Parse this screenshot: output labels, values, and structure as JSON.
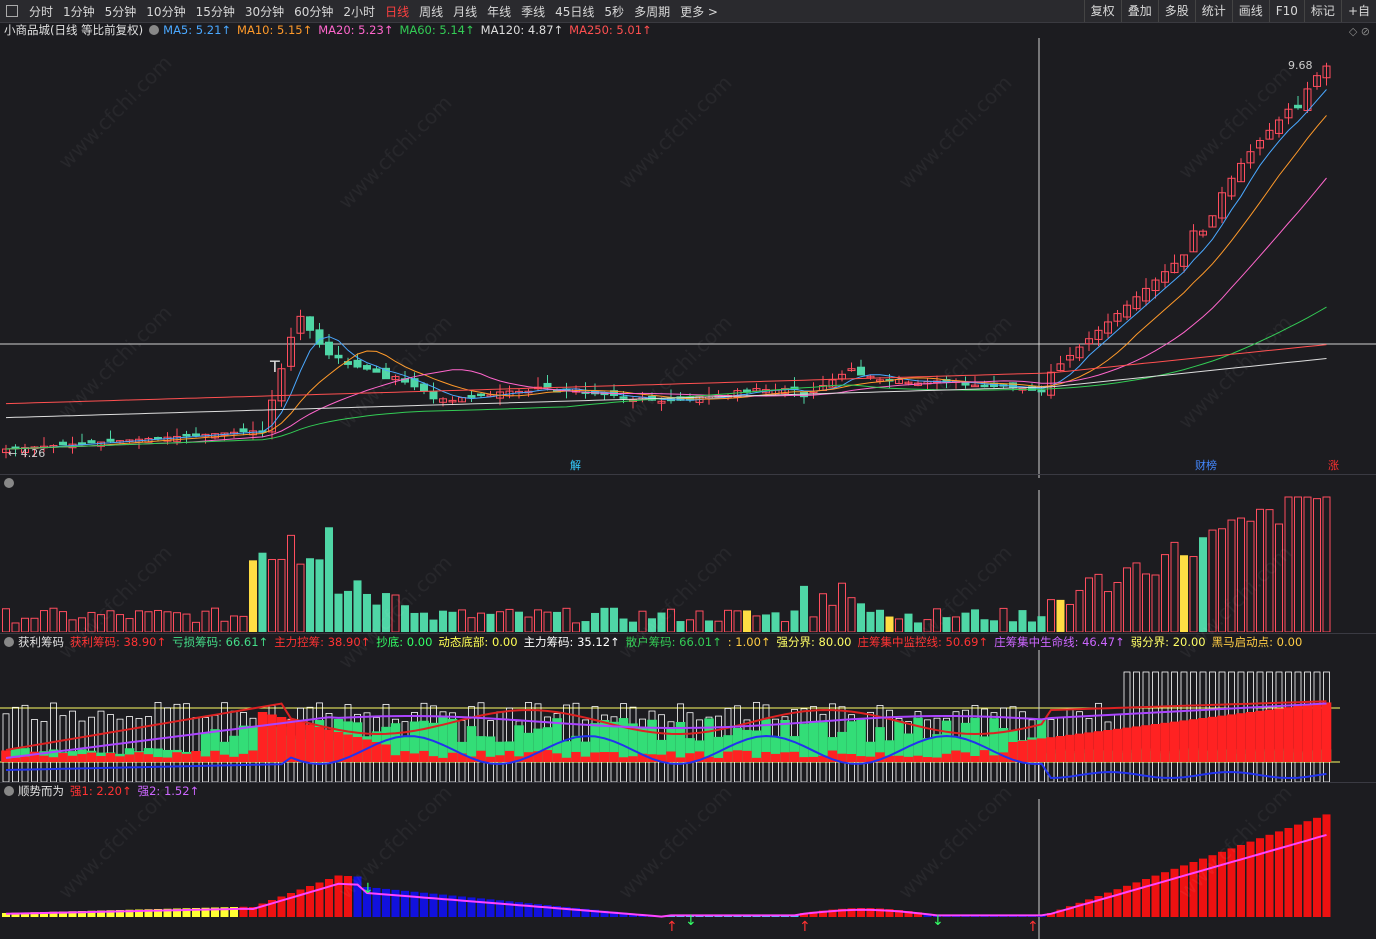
{
  "toolbar": {
    "periods": [
      "分时",
      "1分钟",
      "5分钟",
      "10分钟",
      "15分钟",
      "30分钟",
      "60分钟",
      "2小时",
      "日线",
      "周线",
      "月线",
      "年线",
      "季线",
      "45日线",
      "5秒",
      "多周期",
      "更多 >"
    ],
    "active_period": "日线",
    "tools": [
      "复权",
      "叠加",
      "多股",
      "统计",
      "画线",
      "F10",
      "标记",
      "+自"
    ]
  },
  "main_legend": {
    "title": "小商品城(日线 等比前复权)",
    "ma": [
      {
        "label": "MA5: 5.21↑",
        "color": "#4aa8ff"
      },
      {
        "label": "MA10: 5.15↑",
        "color": "#ff9a2a"
      },
      {
        "label": "MA20: 5.23↑",
        "color": "#ff66cc"
      },
      {
        "label": "MA60: 5.14↑",
        "color": "#33cc55"
      },
      {
        "label": "MA120: 4.87↑",
        "color": "#dddddd"
      },
      {
        "label": "MA250: 5.01↑",
        "color": "#ff5050"
      }
    ],
    "high_label": "9.68",
    "low_label": "4.26",
    "marker_T": "T",
    "events": [
      {
        "text": "解",
        "color": "#33ccff"
      },
      {
        "text": "财榜",
        "color": "#4488ff"
      },
      {
        "text": "涨",
        "color": "#ff3030"
      }
    ]
  },
  "chip_legend": {
    "title": "获利筹码",
    "items": [
      {
        "label": "获利筹码: 38.90↑",
        "color": "#ff3333"
      },
      {
        "label": "亏损筹码: 66.61↑",
        "color": "#44dd88"
      },
      {
        "label": "主力控筹: 38.90↑",
        "color": "#ff3333"
      },
      {
        "label": "抄底: 0.00",
        "color": "#33ff66"
      },
      {
        "label": "动态底部: 0.00",
        "color": "#ffff55"
      },
      {
        "label": "主力筹码: 35.12↑",
        "color": "#ffffff"
      },
      {
        "label": "散户筹码: 66.01↑",
        "color": "#33cc55"
      },
      {
        "label": ": 1.00↑",
        "color": "#ffcc44"
      },
      {
        "label": "强分界: 80.00",
        "color": "#ffff66"
      },
      {
        "label": "庄筹集中监控线: 50.69↑",
        "color": "#ff3333"
      },
      {
        "label": "庄筹集中生命线: 46.47↑",
        "color": "#cc66ff"
      },
      {
        "label": "弱分界: 20.00",
        "color": "#ffff66"
      },
      {
        "label": "黑马启动点: 0.00",
        "color": "#ffcc44"
      }
    ]
  },
  "trend_legend": {
    "title": "顺势而为",
    "items": [
      {
        "label": "强1: 2.20↑",
        "color": "#ff3333"
      },
      {
        "label": "强2: 1.52↑",
        "color": "#cc66ff"
      }
    ]
  },
  "watermark": "www.cfchi.com",
  "colors": {
    "up": "#ff4d5e",
    "down": "#4fd6a6",
    "bg": "#1c1c20"
  }
}
